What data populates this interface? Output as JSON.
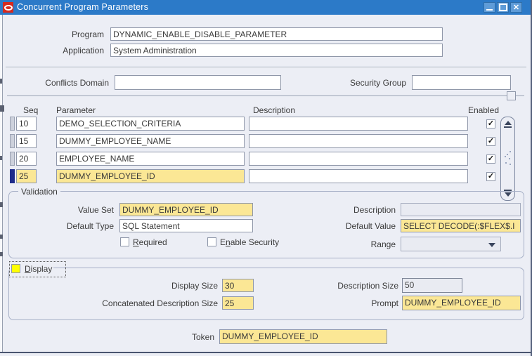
{
  "colors": {
    "titlebar": "#2C7AC8",
    "body_background": "#ECEEF5",
    "field_yellow": "#FBE795",
    "focus_yellow": "#FFFF00",
    "selected_row_indicator": "#1D2B8A",
    "oracle_red": "#D6291E"
  },
  "window": {
    "title": "Concurrent Program Parameters",
    "close_glyph": "✕"
  },
  "header": {
    "program_label": "Program",
    "program_value": "DYNAMIC_ENABLE_DISABLE_PARAMETER",
    "application_label": "Application",
    "application_value": "System Administration"
  },
  "conflicts": {
    "conflicts_domain_label": "Conflicts Domain",
    "conflicts_domain_value": "",
    "security_group_label": "Security Group",
    "security_group_value": ""
  },
  "parameters_table": {
    "headers": {
      "seq": "Seq",
      "parameter": "Parameter",
      "description": "Description",
      "enabled": "Enabled"
    },
    "rows": [
      {
        "seq": "10",
        "parameter": "DEMO_SELECTION_CRITERIA",
        "description": "",
        "enabled_mark": "✓"
      },
      {
        "seq": "15",
        "parameter": "DUMMY_EMPLOYEE_NAME",
        "description": "",
        "enabled_mark": "✓"
      },
      {
        "seq": "20",
        "parameter": "EMPLOYEE_NAME",
        "description": "",
        "enabled_mark": "✓"
      },
      {
        "seq": "25",
        "parameter": "DUMMY_EMPLOYEE_ID",
        "description": "",
        "enabled_mark": "✓"
      }
    ],
    "selected_seq": "25"
  },
  "validation": {
    "legend": "Validation",
    "value_set_label": "Value Set",
    "value_set_value": "DUMMY_EMPLOYEE_ID",
    "default_type_label": "Default Type",
    "default_type_value": "SQL Statement",
    "required": {
      "pre": "",
      "mn": "R",
      "post": "equired"
    },
    "enable_security": {
      "pre": "E",
      "mn": "n",
      "post": "able Security"
    },
    "description_label": "Description",
    "description_value": "",
    "default_value_label": "Default Value",
    "default_value_value": "SELECT DECODE(:$FLEX$.I",
    "range_label": "Range",
    "range_value": ""
  },
  "display": {
    "legend": {
      "pre": "",
      "mn": "D",
      "post": "isplay"
    },
    "display_size_label": "Display Size",
    "display_size_value": "30",
    "description_size_label": "Description Size",
    "description_size_value": "50",
    "concatenated_label": "Concatenated Description Size",
    "concatenated_value": "25",
    "prompt_label": "Prompt",
    "prompt_value": "DUMMY_EMPLOYEE_ID"
  },
  "token": {
    "label": "Token",
    "value": "DUMMY_EMPLOYEE_ID"
  }
}
